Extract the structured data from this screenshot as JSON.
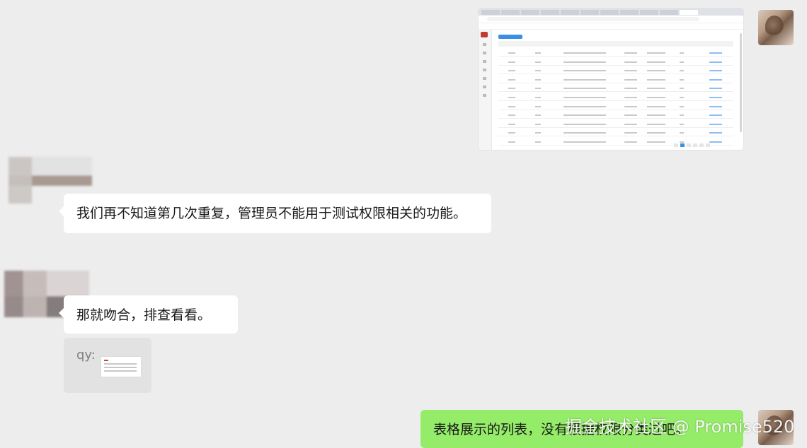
{
  "messages": [
    {
      "sender": "self",
      "type": "image",
      "image": {
        "kind": "browser-screenshot",
        "accent": "#3b8ee6",
        "brand": "#c23b30",
        "table_rows": 11
      }
    },
    {
      "sender": "other-1",
      "type": "text",
      "text": "我们再不知道第几次重复，管理员不能用于测试权限相关的功能。"
    },
    {
      "sender": "other-2",
      "type": "text",
      "text": "那就吻合，排查看看。"
    },
    {
      "sender": "other-2",
      "type": "quote",
      "quote_prefix": "qy:"
    },
    {
      "sender": "self",
      "type": "text",
      "text": "表格展示的列表，没有根据权限分类过吧。"
    }
  ],
  "watermark": "掘金技术社区 @ Promise520",
  "colors": {
    "background": "#ededed",
    "bubble_other": "#ffffff",
    "bubble_self": "#95ec69"
  }
}
